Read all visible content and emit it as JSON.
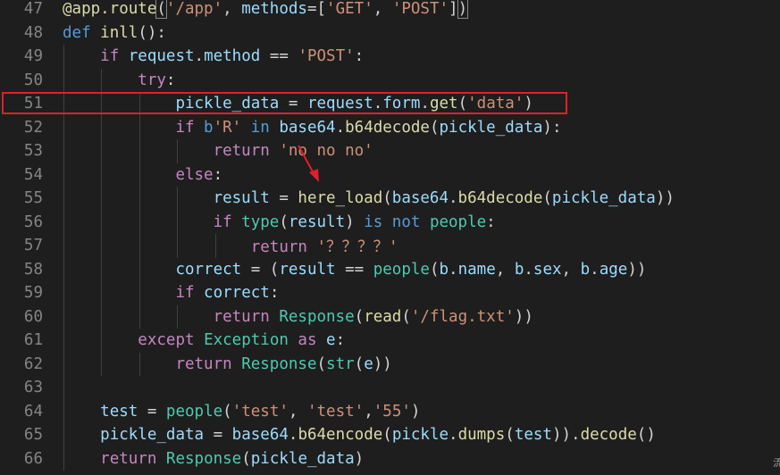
{
  "editor": {
    "lines": [
      {
        "num": "47",
        "tokens": [
          {
            "t": "@app.route",
            "c": "dec"
          },
          {
            "t": "(",
            "c": "txt",
            "box": true
          },
          {
            "t": "'/app'",
            "c": "str"
          },
          {
            "t": ", ",
            "c": "txt"
          },
          {
            "t": "methods",
            "c": "var"
          },
          {
            "t": "=[",
            "c": "txt"
          },
          {
            "t": "'GET'",
            "c": "str"
          },
          {
            "t": ", ",
            "c": "txt"
          },
          {
            "t": "'POST'",
            "c": "str"
          },
          {
            "t": "]",
            "c": "txt"
          },
          {
            "t": ")",
            "c": "txt",
            "box": true
          }
        ]
      },
      {
        "num": "48",
        "tokens": [
          {
            "t": "def ",
            "c": "kw"
          },
          {
            "t": "inll",
            "c": "fn"
          },
          {
            "t": "():",
            "c": "txt"
          }
        ]
      },
      {
        "num": "49",
        "tokens": [
          {
            "t": "    ",
            "c": "txt"
          },
          {
            "t": "if ",
            "c": "ctl"
          },
          {
            "t": "request",
            "c": "var"
          },
          {
            "t": ".",
            "c": "txt"
          },
          {
            "t": "method",
            "c": "var"
          },
          {
            "t": " == ",
            "c": "txt"
          },
          {
            "t": "'POST'",
            "c": "str"
          },
          {
            "t": ":",
            "c": "txt"
          }
        ]
      },
      {
        "num": "50",
        "tokens": [
          {
            "t": "        ",
            "c": "txt"
          },
          {
            "t": "try",
            "c": "ctl"
          },
          {
            "t": ":",
            "c": "txt"
          }
        ]
      },
      {
        "num": "51",
        "tokens": [
          {
            "t": "            ",
            "c": "txt"
          },
          {
            "t": "pickle_data",
            "c": "var"
          },
          {
            "t": " = ",
            "c": "txt"
          },
          {
            "t": "request",
            "c": "var"
          },
          {
            "t": ".",
            "c": "txt"
          },
          {
            "t": "form",
            "c": "var"
          },
          {
            "t": ".",
            "c": "txt"
          },
          {
            "t": "get",
            "c": "fn"
          },
          {
            "t": "(",
            "c": "txt"
          },
          {
            "t": "'data'",
            "c": "str"
          },
          {
            "t": ")",
            "c": "txt"
          }
        ]
      },
      {
        "num": "52",
        "tokens": [
          {
            "t": "            ",
            "c": "txt"
          },
          {
            "t": "if ",
            "c": "ctl"
          },
          {
            "t": "b",
            "c": "kw"
          },
          {
            "t": "'R'",
            "c": "str"
          },
          {
            "t": " in ",
            "c": "kw"
          },
          {
            "t": "base64",
            "c": "var"
          },
          {
            "t": ".",
            "c": "txt"
          },
          {
            "t": "b64decode",
            "c": "fn"
          },
          {
            "t": "(",
            "c": "txt"
          },
          {
            "t": "pickle_data",
            "c": "var"
          },
          {
            "t": "):",
            "c": "txt"
          }
        ]
      },
      {
        "num": "53",
        "tokens": [
          {
            "t": "                ",
            "c": "txt"
          },
          {
            "t": "return ",
            "c": "ctl"
          },
          {
            "t": "'no no no'",
            "c": "str"
          }
        ]
      },
      {
        "num": "54",
        "tokens": [
          {
            "t": "            ",
            "c": "txt"
          },
          {
            "t": "else",
            "c": "ctl"
          },
          {
            "t": ":",
            "c": "txt"
          }
        ]
      },
      {
        "num": "55",
        "tokens": [
          {
            "t": "                ",
            "c": "txt"
          },
          {
            "t": "result",
            "c": "var"
          },
          {
            "t": " = ",
            "c": "txt"
          },
          {
            "t": "here_load",
            "c": "fn"
          },
          {
            "t": "(",
            "c": "txt"
          },
          {
            "t": "base64",
            "c": "var"
          },
          {
            "t": ".",
            "c": "txt"
          },
          {
            "t": "b64decode",
            "c": "fn"
          },
          {
            "t": "(",
            "c": "txt"
          },
          {
            "t": "pickle_data",
            "c": "var"
          },
          {
            "t": "))",
            "c": "txt"
          }
        ]
      },
      {
        "num": "56",
        "tokens": [
          {
            "t": "                ",
            "c": "txt"
          },
          {
            "t": "if ",
            "c": "ctl"
          },
          {
            "t": "type",
            "c": "cls"
          },
          {
            "t": "(",
            "c": "txt"
          },
          {
            "t": "result",
            "c": "var"
          },
          {
            "t": ") ",
            "c": "txt"
          },
          {
            "t": "is not ",
            "c": "kw"
          },
          {
            "t": "people",
            "c": "cls"
          },
          {
            "t": ":",
            "c": "txt"
          }
        ]
      },
      {
        "num": "57",
        "tokens": [
          {
            "t": "                    ",
            "c": "txt"
          },
          {
            "t": "return ",
            "c": "ctl"
          },
          {
            "t": "'？？？？'",
            "c": "str"
          }
        ]
      },
      {
        "num": "58",
        "tokens": [
          {
            "t": "            ",
            "c": "txt"
          },
          {
            "t": "correct",
            "c": "var"
          },
          {
            "t": " = (",
            "c": "txt"
          },
          {
            "t": "result",
            "c": "var"
          },
          {
            "t": " == ",
            "c": "txt"
          },
          {
            "t": "people",
            "c": "cls"
          },
          {
            "t": "(",
            "c": "txt"
          },
          {
            "t": "b",
            "c": "var"
          },
          {
            "t": ".",
            "c": "txt"
          },
          {
            "t": "name",
            "c": "var"
          },
          {
            "t": ", ",
            "c": "txt"
          },
          {
            "t": "b",
            "c": "var"
          },
          {
            "t": ".",
            "c": "txt"
          },
          {
            "t": "sex",
            "c": "var"
          },
          {
            "t": ", ",
            "c": "txt"
          },
          {
            "t": "b",
            "c": "var"
          },
          {
            "t": ".",
            "c": "txt"
          },
          {
            "t": "age",
            "c": "var"
          },
          {
            "t": "))",
            "c": "txt"
          }
        ]
      },
      {
        "num": "59",
        "tokens": [
          {
            "t": "            ",
            "c": "txt"
          },
          {
            "t": "if ",
            "c": "ctl"
          },
          {
            "t": "correct",
            "c": "var"
          },
          {
            "t": ":",
            "c": "txt"
          }
        ]
      },
      {
        "num": "60",
        "tokens": [
          {
            "t": "                ",
            "c": "txt"
          },
          {
            "t": "return ",
            "c": "ctl"
          },
          {
            "t": "Response",
            "c": "cls"
          },
          {
            "t": "(",
            "c": "txt"
          },
          {
            "t": "read",
            "c": "fn"
          },
          {
            "t": "(",
            "c": "txt"
          },
          {
            "t": "'/flag.txt'",
            "c": "str"
          },
          {
            "t": "))",
            "c": "txt"
          }
        ]
      },
      {
        "num": "61",
        "tokens": [
          {
            "t": "        ",
            "c": "txt"
          },
          {
            "t": "except ",
            "c": "ctl"
          },
          {
            "t": "Exception",
            "c": "cls"
          },
          {
            "t": " as ",
            "c": "ctl"
          },
          {
            "t": "e",
            "c": "var"
          },
          {
            "t": ":",
            "c": "txt"
          }
        ]
      },
      {
        "num": "62",
        "tokens": [
          {
            "t": "            ",
            "c": "txt"
          },
          {
            "t": "return ",
            "c": "ctl"
          },
          {
            "t": "Response",
            "c": "cls"
          },
          {
            "t": "(",
            "c": "txt"
          },
          {
            "t": "str",
            "c": "cls"
          },
          {
            "t": "(",
            "c": "txt"
          },
          {
            "t": "e",
            "c": "var"
          },
          {
            "t": "))",
            "c": "txt"
          }
        ]
      },
      {
        "num": "63",
        "tokens": []
      },
      {
        "num": "64",
        "tokens": [
          {
            "t": "    ",
            "c": "txt"
          },
          {
            "t": "test",
            "c": "var"
          },
          {
            "t": " = ",
            "c": "txt"
          },
          {
            "t": "people",
            "c": "cls"
          },
          {
            "t": "(",
            "c": "txt"
          },
          {
            "t": "'test'",
            "c": "str"
          },
          {
            "t": ", ",
            "c": "txt"
          },
          {
            "t": "'test'",
            "c": "str"
          },
          {
            "t": ",",
            "c": "txt"
          },
          {
            "t": "'55'",
            "c": "str"
          },
          {
            "t": ")",
            "c": "txt"
          }
        ]
      },
      {
        "num": "65",
        "tokens": [
          {
            "t": "    ",
            "c": "txt"
          },
          {
            "t": "pickle_data",
            "c": "var"
          },
          {
            "t": " = ",
            "c": "txt"
          },
          {
            "t": "base64",
            "c": "var"
          },
          {
            "t": ".",
            "c": "txt"
          },
          {
            "t": "b64encode",
            "c": "fn"
          },
          {
            "t": "(",
            "c": "txt"
          },
          {
            "t": "pickle",
            "c": "var"
          },
          {
            "t": ".",
            "c": "txt"
          },
          {
            "t": "dumps",
            "c": "fn"
          },
          {
            "t": "(",
            "c": "txt"
          },
          {
            "t": "test",
            "c": "var"
          },
          {
            "t": ")).",
            "c": "txt"
          },
          {
            "t": "decode",
            "c": "fn"
          },
          {
            "t": "()",
            "c": "txt"
          }
        ]
      },
      {
        "num": "66",
        "tokens": [
          {
            "t": "    ",
            "c": "txt"
          },
          {
            "t": "return ",
            "c": "ctl"
          },
          {
            "t": "Response",
            "c": "cls"
          },
          {
            "t": "(",
            "c": "txt"
          },
          {
            "t": "pickle_data",
            "c": "var"
          },
          {
            "t": ")",
            "c": "txt"
          }
        ]
      }
    ]
  },
  "annotation": {
    "highlight_color": "#e0202a",
    "arrow_color": "#e0202a"
  },
  "corner_mark": "流"
}
